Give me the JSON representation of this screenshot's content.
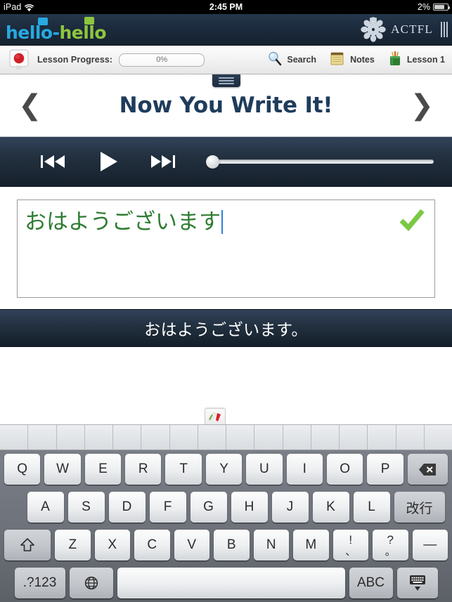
{
  "status_bar": {
    "device": "iPad",
    "wifi_icon": "wifi-icon",
    "time": "2:45 PM",
    "battery_percent": "2%",
    "battery_icon": "battery-icon"
  },
  "nav_bar": {
    "logo_part1": "hello",
    "logo_dash": "-",
    "logo_part2": "hello",
    "logo_colors": {
      "blue": "#27a9e1",
      "green": "#8dc63f"
    },
    "partner_logo_text": "ACTFL",
    "partner_logo_icon": "actfl-rosette-icon",
    "grip_icon": "grip-lines-icon"
  },
  "toolbar": {
    "language_flag_icon": "japan-flag-icon",
    "progress_label": "Lesson Progress:",
    "progress_value": "0%",
    "items": [
      {
        "label": "Search",
        "icon": "magnifier-icon"
      },
      {
        "label": "Notes",
        "icon": "notepad-icon"
      },
      {
        "label": "Lesson 1",
        "icon": "pencil-cup-icon"
      }
    ]
  },
  "title_bar": {
    "drawer_handle_icon": "drawer-handle-icon",
    "prev_icon": "chevron-left-icon",
    "title": "Now You Write It!",
    "next_icon": "chevron-right-icon"
  },
  "player": {
    "prev_icon": "rewind-icon",
    "play_icon": "play-icon",
    "next_icon": "fast-forward-icon",
    "progress_percent": 0
  },
  "answer": {
    "typed_text": "おはようございます",
    "text_color": "#2e7d32",
    "caret_color": "#2f7fe0",
    "correct_icon": "green-checkmark-icon"
  },
  "prompt": {
    "sentence": "おはようございます。"
  },
  "keyboard": {
    "ime_app_icon": "ime-pen-icon",
    "candidate_cells": 16,
    "rows": [
      {
        "id": "row-1",
        "keys": [
          {
            "label": "Q",
            "name": "key-q",
            "class": "w-letter"
          },
          {
            "label": "W",
            "name": "key-w",
            "class": "w-letter"
          },
          {
            "label": "E",
            "name": "key-e",
            "class": "w-letter"
          },
          {
            "label": "R",
            "name": "key-r",
            "class": "w-letter"
          },
          {
            "label": "T",
            "name": "key-t",
            "class": "w-letter"
          },
          {
            "label": "Y",
            "name": "key-y",
            "class": "w-letter"
          },
          {
            "label": "U",
            "name": "key-u",
            "class": "w-letter"
          },
          {
            "label": "I",
            "name": "key-i",
            "class": "w-letter"
          },
          {
            "label": "O",
            "name": "key-o",
            "class": "w-letter"
          },
          {
            "label": "P",
            "name": "key-p",
            "class": "w-letter"
          },
          {
            "label": "⌫",
            "name": "key-backspace",
            "class": "w-back dark"
          }
        ]
      },
      {
        "id": "row-2",
        "keys": [
          {
            "label": "A",
            "name": "key-a",
            "class": "w-letter"
          },
          {
            "label": "S",
            "name": "key-s",
            "class": "w-letter"
          },
          {
            "label": "D",
            "name": "key-d",
            "class": "w-letter"
          },
          {
            "label": "F",
            "name": "key-f",
            "class": "w-letter"
          },
          {
            "label": "G",
            "name": "key-g",
            "class": "w-letter"
          },
          {
            "label": "H",
            "name": "key-h",
            "class": "w-letter"
          },
          {
            "label": "J",
            "name": "key-j",
            "class": "w-letter"
          },
          {
            "label": "K",
            "name": "key-k",
            "class": "w-letter"
          },
          {
            "label": "L",
            "name": "key-l",
            "class": "w-letter"
          },
          {
            "label": "改行",
            "name": "key-return",
            "class": "w-ret dark"
          }
        ]
      },
      {
        "id": "row-3",
        "keys": [
          {
            "label": "⇧",
            "name": "key-shift",
            "class": "w-shift dark"
          },
          {
            "label": "Z",
            "name": "key-z",
            "class": "w-letter"
          },
          {
            "label": "X",
            "name": "key-x",
            "class": "w-letter"
          },
          {
            "label": "C",
            "name": "key-c",
            "class": "w-letter"
          },
          {
            "label": "V",
            "name": "key-v",
            "class": "w-letter"
          },
          {
            "label": "B",
            "name": "key-b",
            "class": "w-letter"
          },
          {
            "label": "N",
            "name": "key-n",
            "class": "w-letter"
          },
          {
            "label": "M",
            "name": "key-m",
            "class": "w-letter"
          },
          {
            "label": "!",
            "sublabel": "、",
            "name": "key-exclaim-comma",
            "class": "w-punct"
          },
          {
            "label": "?",
            "sublabel": "。",
            "name": "key-question-period",
            "class": "w-punct"
          },
          {
            "label": "—",
            "name": "key-dash",
            "class": "w-punct"
          }
        ]
      },
      {
        "id": "row-4",
        "keys": [
          {
            "label": ".?123",
            "name": "key-numbers",
            "class": "w-num dark small"
          },
          {
            "label": "🌐",
            "name": "key-globe",
            "class": "w-globe dark"
          },
          {
            "label": "",
            "name": "key-space",
            "class": "w-space"
          },
          {
            "label": "ABC",
            "name": "key-abc",
            "class": "w-abc dark small"
          },
          {
            "label": "",
            "name": "key-hide-keyboard",
            "class": "w-hide dark"
          }
        ]
      }
    ]
  }
}
